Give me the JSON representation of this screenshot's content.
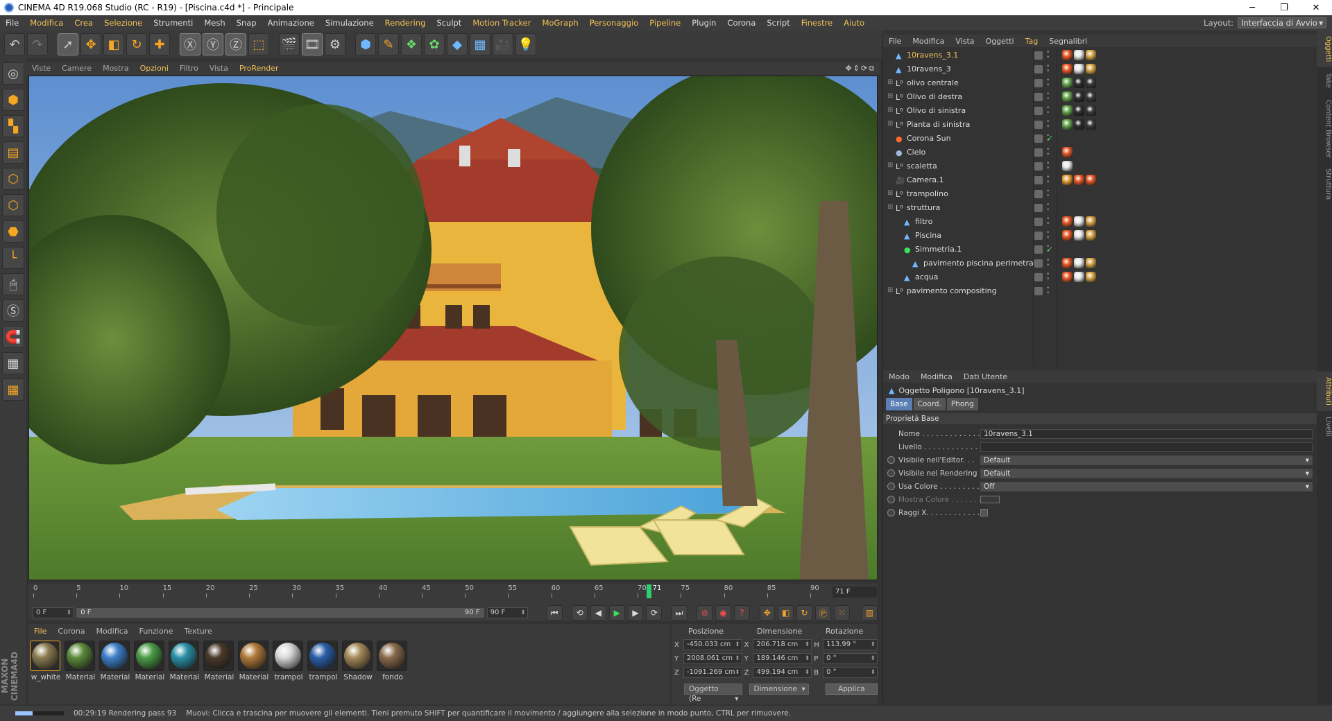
{
  "window": {
    "title": "CINEMA 4D R19.068 Studio (RC - R19) - [Piscina.c4d *] - Principale",
    "min": "─",
    "max": "❐",
    "close": "✕"
  },
  "menubar": {
    "items": [
      "File",
      "Modifica",
      "Crea",
      "Selezione",
      "Strumenti",
      "Mesh",
      "Snap",
      "Animazione",
      "Simulazione",
      "Rendering",
      "Sculpt",
      "Motion Tracker",
      "MoGraph",
      "Personaggio",
      "Pipeline",
      "Plugin",
      "Corona",
      "Script",
      "Finestre",
      "Aiuto"
    ],
    "layout_label": "Layout:",
    "layout_value": "Interfaccia di Avvio"
  },
  "viewport": {
    "menu": [
      "Viste",
      "Camere",
      "Mostra",
      "Opzioni",
      "Filtro",
      "Vista",
      "ProRender"
    ]
  },
  "timeline": {
    "ticks": [
      "0",
      "5",
      "10",
      "15",
      "20",
      "25",
      "30",
      "35",
      "40",
      "45",
      "50",
      "55",
      "60",
      "65",
      "70",
      "75",
      "80",
      "85",
      "90"
    ],
    "current": "71",
    "frame_field": "71 F",
    "start": "0 F",
    "range_start": "0 F",
    "range_end": "90 F",
    "end": "90 F",
    "current_fraction": 0.789
  },
  "materials": {
    "menu": [
      "File",
      "Corona",
      "Modifica",
      "Funzione",
      "Texture"
    ],
    "items": [
      {
        "label": "w_white",
        "color": "#8a7a50"
      },
      {
        "label": "Material",
        "color": "#5c8a3a"
      },
      {
        "label": "Material",
        "color": "#3d7fc9"
      },
      {
        "label": "Material",
        "color": "#4b9b46"
      },
      {
        "label": "Material",
        "color": "#2a8fa6"
      },
      {
        "label": "Material",
        "color": "#4a3a2a"
      },
      {
        "label": "Material",
        "color": "#b07a3a"
      },
      {
        "label": "trampol",
        "color": "#d8d8d8"
      },
      {
        "label": "trampol",
        "color": "#2a5fa8"
      },
      {
        "label": "Shadow",
        "color": "#a58a5a"
      },
      {
        "label": "fondo",
        "color": "#8a6a4a"
      }
    ]
  },
  "coords": {
    "headers": [
      "Posizione",
      "Dimensione",
      "Rotazione"
    ],
    "rows": [
      {
        "a": "X",
        "pos": "-450.033 cm",
        "b": "X",
        "dim": "206.718 cm",
        "c": "H",
        "rot": "113.99 °"
      },
      {
        "a": "Y",
        "pos": "2008.061 cm",
        "b": "Y",
        "dim": "189.146 cm",
        "c": "P",
        "rot": "0 °"
      },
      {
        "a": "Z",
        "pos": "-1091.269 cm",
        "b": "Z",
        "dim": "499.194 cm",
        "c": "B",
        "rot": "0 °"
      }
    ],
    "mode1": "Oggetto (Re",
    "mode2": "Dimensione",
    "apply": "Applica"
  },
  "status": {
    "progress": 0.35,
    "time": "00:29:19 Rendering pass 93",
    "hint": "Muovi: Clicca e trascina per muovere gli elementi. Tieni premuto SHIFT per quantificare il movimento / aggiungere alla selezione in modo punto, CTRL per rimuovere."
  },
  "objects": {
    "menu": [
      "File",
      "Modifica",
      "Vista",
      "Oggetti",
      "Tag",
      "Segnalibri"
    ],
    "rows": [
      {
        "name": "10ravens_3.1",
        "depth": 0,
        "icon": "poly",
        "selected": true
      },
      {
        "name": "10ravens_3",
        "depth": 0,
        "icon": "poly"
      },
      {
        "name": "olivo centrale",
        "depth": 0,
        "icon": "null"
      },
      {
        "name": "Olivo di destra",
        "depth": 0,
        "icon": "null"
      },
      {
        "name": "Olivo di sinistra",
        "depth": 0,
        "icon": "null"
      },
      {
        "name": "Pianta di sinistra",
        "depth": 0,
        "icon": "null"
      },
      {
        "name": "Corona Sun",
        "depth": 0,
        "icon": "sun"
      },
      {
        "name": "Cielo",
        "depth": 0,
        "icon": "sky"
      },
      {
        "name": "scaletta",
        "depth": 0,
        "icon": "null"
      },
      {
        "name": "Camera.1",
        "depth": 0,
        "icon": "cam"
      },
      {
        "name": "trampolino",
        "depth": 0,
        "icon": "null"
      },
      {
        "name": "struttura",
        "depth": 0,
        "icon": "null"
      },
      {
        "name": "filtro",
        "depth": 1,
        "icon": "poly"
      },
      {
        "name": "Piscina",
        "depth": 1,
        "icon": "poly"
      },
      {
        "name": "Simmetria.1",
        "depth": 1,
        "icon": "sym"
      },
      {
        "name": "pavimento piscina perimetrale",
        "depth": 2,
        "icon": "poly"
      },
      {
        "name": "acqua",
        "depth": 1,
        "icon": "poly"
      },
      {
        "name": "pavimento compositing",
        "depth": 0,
        "icon": "null"
      }
    ]
  },
  "attributes": {
    "menu": [
      "Modo",
      "Modifica",
      "Dati Utente"
    ],
    "title": "Oggetto Poligono [10ravens_3.1]",
    "tabs": [
      "Base",
      "Coord.",
      "Phong"
    ],
    "section": "Proprietà Base",
    "props": [
      {
        "label": "Nome . . . . . . . . . . . . . . .",
        "value": "10ravens_3.1",
        "type": "text",
        "radio": false
      },
      {
        "label": "Livello . . . . . . . . . . . . . .",
        "value": "",
        "type": "text",
        "radio": false
      },
      {
        "label": "Visibile nell'Editor. . .",
        "value": "Default",
        "type": "dd",
        "radio": true
      },
      {
        "label": "Visibile nel Rendering",
        "value": "Default",
        "type": "dd",
        "radio": true
      },
      {
        "label": "Usa Colore . . . . . . . . .",
        "value": "Off",
        "type": "dd",
        "radio": true
      },
      {
        "label": "Mostra Colore . . . . . . .",
        "value": "",
        "type": "swatch",
        "radio": true,
        "dim": true
      },
      {
        "label": "Raggi X. . . . . . . . . . . . .",
        "value": "",
        "type": "check",
        "radio": true
      }
    ]
  },
  "sidetabs": [
    "Oggetti",
    "Take",
    "Content Browser",
    "Struttura",
    "Attributi",
    "Livelli"
  ]
}
